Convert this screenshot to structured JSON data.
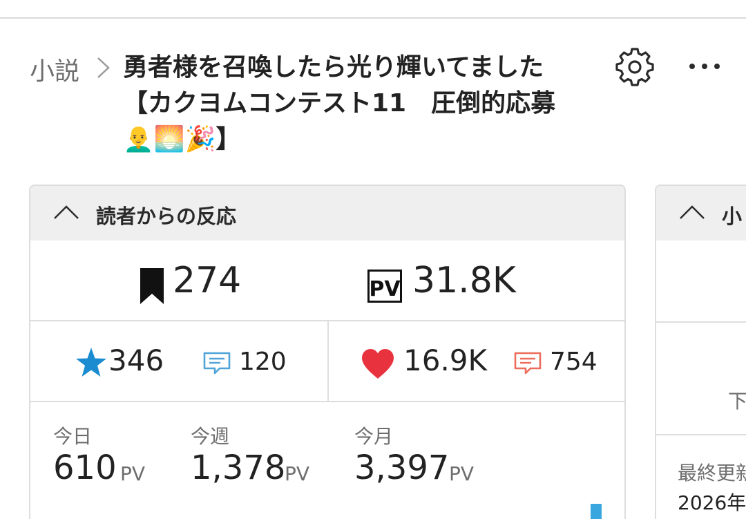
{
  "breadcrumb": {
    "category": "小説"
  },
  "work": {
    "title": "勇者様を召喚したら光り輝いてました【カクヨムコンテスト11　圧倒的応募👨‍🦲🌅🎉】"
  },
  "reactions": {
    "header": "読者からの反応",
    "bookmarks": "274",
    "pv_total": "31.8K",
    "stars": "346",
    "reviews": "120",
    "hearts": "16.9K",
    "comments": "754"
  },
  "pv_stats": {
    "today_label": "今日",
    "today_value": "610",
    "week_label": "今週",
    "week_value": "1,378",
    "month_label": "今月",
    "month_value": "3,397",
    "unit": "PV"
  },
  "side_card": {
    "header_partial": "小",
    "label_partial": "下",
    "last_updated_label_partial": "最終更新",
    "last_updated_value_partial": "2026年"
  },
  "colors": {
    "star": "#1a8ccf",
    "heart": "#e8333f",
    "review_icon": "#4fa3d8",
    "comment_icon": "#ec6d5c",
    "bar": "#3aa6e0"
  }
}
